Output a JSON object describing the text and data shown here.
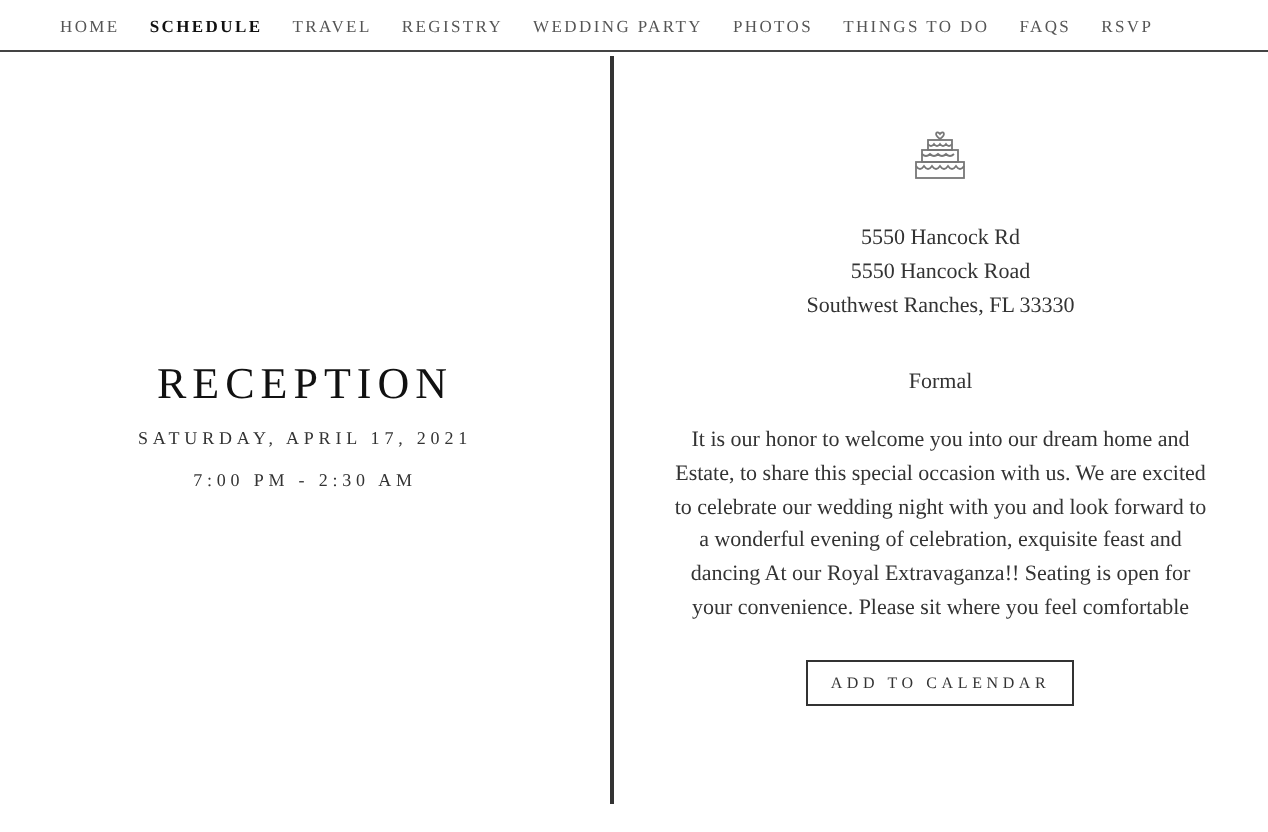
{
  "nav": [
    {
      "label": "HOME",
      "selected": false
    },
    {
      "label": "SCHEDULE",
      "selected": true
    },
    {
      "label": "TRAVEL",
      "selected": false
    },
    {
      "label": "REGISTRY",
      "selected": false
    },
    {
      "label": "WEDDING PARTY",
      "selected": false
    },
    {
      "label": "PHOTOS",
      "selected": false
    },
    {
      "label": "THINGS TO DO",
      "selected": false
    },
    {
      "label": "FAQS",
      "selected": false
    },
    {
      "label": "RSVP",
      "selected": false
    }
  ],
  "event": {
    "title": "RECEPTION",
    "date": "SATURDAY, APRIL 17, 2021",
    "time": "7:00 PM - 2:30 AM"
  },
  "details": {
    "address": [
      "5550 Hancock Rd",
      "5550 Hancock Road",
      "Southwest Ranches, FL 33330"
    ],
    "attire": "Formal",
    "description": "It is our honor to welcome you into our dream home and Estate, to share this special occasion with us. We are excited to celebrate our wedding night with you and look forward to a wonderful evening of celebration, exquisite feast and dancing At our Royal Extravaganza!! Seating is open for your convenience. Please sit where you feel comfortable",
    "button": "ADD TO CALENDAR"
  }
}
